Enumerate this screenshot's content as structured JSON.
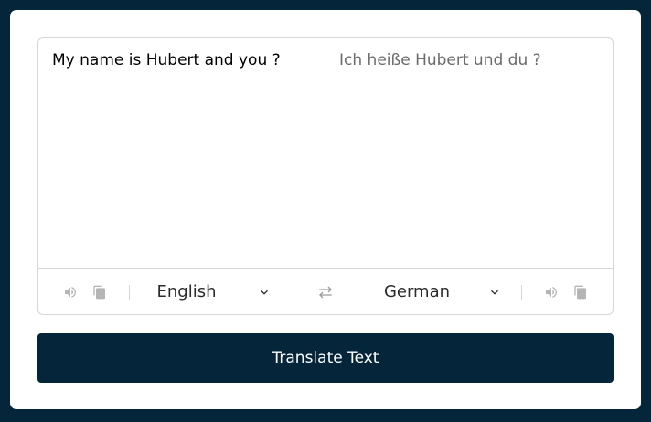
{
  "translator": {
    "source_text": "My name is Hubert and you ?",
    "target_text": "Ich heiße Hubert und du ?",
    "source_language": "English",
    "target_language": "German"
  },
  "actions": {
    "translate_label": "Translate Text"
  },
  "icons": {
    "speaker": "speaker-icon",
    "copy": "copy-icon",
    "chevron": "chevron-down-icon",
    "exchange": "exchange-icon"
  },
  "colors": {
    "background": "#05263a",
    "card": "#ffffff",
    "border": "#d6d6d6",
    "icon": "#b5b5b5",
    "button": "#05263a",
    "button_text": "#ffffff"
  }
}
